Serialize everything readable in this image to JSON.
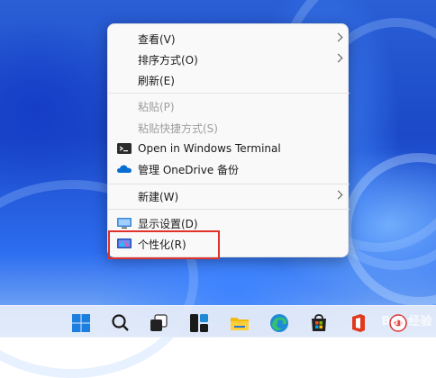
{
  "context_menu": {
    "items": [
      {
        "label": "查看(V)",
        "has_submenu": true,
        "disabled": false
      },
      {
        "label": "排序方式(O)",
        "has_submenu": true,
        "disabled": false
      },
      {
        "label": "刷新(E)",
        "has_submenu": false,
        "disabled": false
      },
      {
        "label": "粘贴(P)",
        "has_submenu": false,
        "disabled": true
      },
      {
        "label": "粘贴快捷方式(S)",
        "has_submenu": false,
        "disabled": true
      },
      {
        "label": "Open in Windows Terminal",
        "icon": "terminal-icon",
        "disabled": false
      },
      {
        "label": "管理 OneDrive 备份",
        "icon": "onedrive-cloud-icon",
        "disabled": false
      },
      {
        "label": "新建(W)",
        "has_submenu": true,
        "disabled": false
      },
      {
        "label": "显示设置(D)",
        "icon": "display-settings-icon",
        "disabled": false
      },
      {
        "label": "个性化(R)",
        "icon": "personalize-icon",
        "disabled": false,
        "highlighted": true
      }
    ]
  },
  "taskbar": {
    "icons": [
      "start-windows-icon",
      "search-icon",
      "task-view-icon",
      "widgets-icon",
      "file-explorer-icon",
      "edge-browser-icon",
      "microsoft-store-icon",
      "office-icon",
      "app-icon"
    ]
  },
  "watermark": {
    "text": "Bai 经验"
  },
  "colors": {
    "highlight_border": "#e0332b",
    "menu_bg": "#f9f9f9",
    "accent": "#0078d4"
  }
}
